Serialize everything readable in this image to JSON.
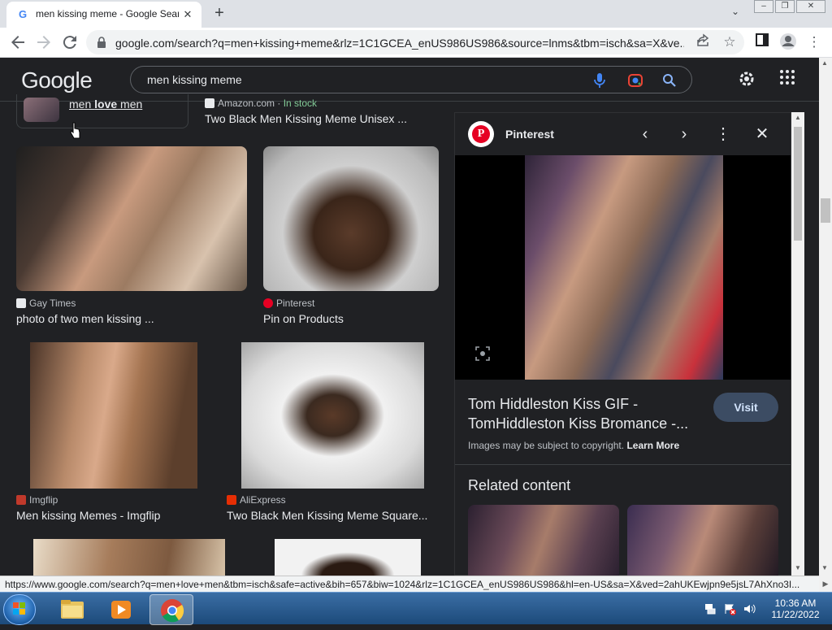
{
  "browser": {
    "tab_title": "men kissing meme - Google Search",
    "favicon_letter": "G",
    "url": "google.com/search?q=men+kissing+meme&rlz=1C1GCEA_enUS986US986&source=lnms&tbm=isch&sa=X&ve...",
    "icons": [
      "back-arrow-icon",
      "forward-arrow-icon",
      "reload-icon",
      "lock-icon",
      "share-icon",
      "star-icon",
      "sidepanel-icon",
      "profile-icon",
      "kebab-menu-icon"
    ]
  },
  "google": {
    "logo": "Google",
    "query": "men kissing meme"
  },
  "results": {
    "top_left_link": {
      "pre": "men ",
      "bold": "love",
      "post": " men"
    },
    "top_right": {
      "source": "Amazon.com",
      "stock": "In stock",
      "title": "Two Black Men Kissing Meme Unisex ..."
    },
    "items": [
      {
        "source": "Gay Times",
        "caption": "photo of two men kissing ...",
        "color": "#e8eaed"
      },
      {
        "source": "Pinterest",
        "caption": "Pin on Products",
        "color": "#e60023"
      },
      {
        "source": "Imgflip",
        "caption": "Men kissing Memes - Imgflip",
        "color": "#c0392b"
      },
      {
        "source": "AliExpress",
        "caption": "Two Black Men Kissing Meme Square...",
        "color": "#e62e04"
      }
    ]
  },
  "panel": {
    "site": "Pinterest",
    "title": "Tom Hiddleston Kiss GIF - TomHiddleston Kiss Bromance -...",
    "visit_label": "Visit",
    "copyright_text": "Images may be subject to copyright.",
    "learn_more": "Learn More",
    "related_heading": "Related content"
  },
  "status_url": "https://www.google.com/search?q=men+love+men&tbm=isch&safe=active&bih=657&biw=1024&rlz=1C1GCEA_enUS986US986&hl=en-US&sa=X&ved=2ahUKEwjpn9e5jsL7AhXno3I...",
  "taskbar": {
    "time": "10:36 AM",
    "date": "11/22/2022"
  }
}
